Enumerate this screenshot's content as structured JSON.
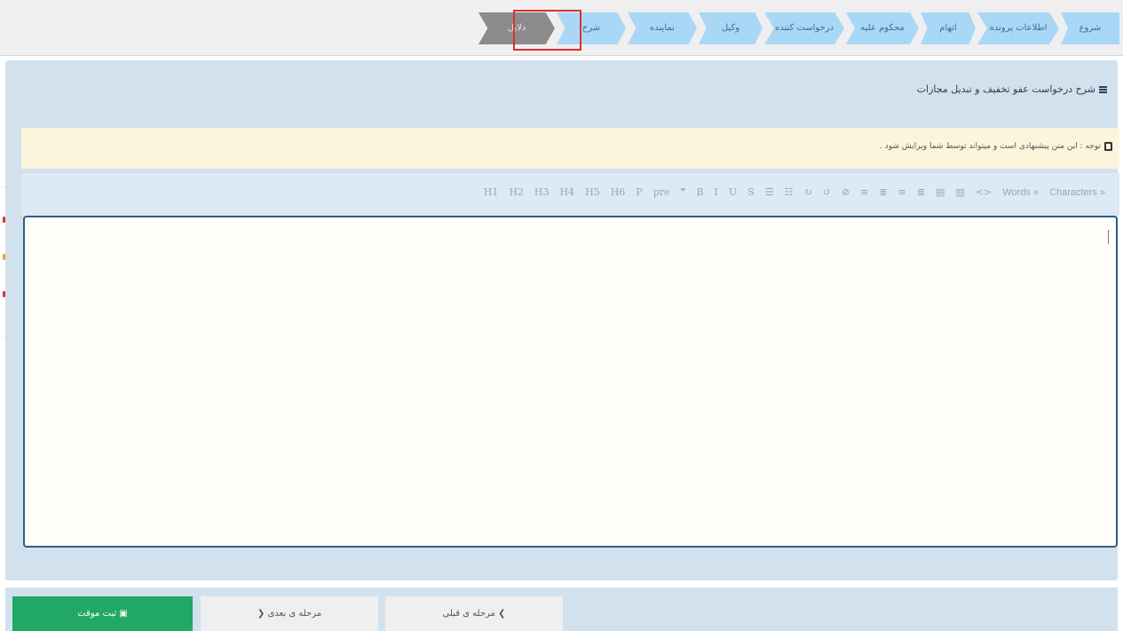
{
  "steps": [
    {
      "label": "شروع",
      "state": "normal"
    },
    {
      "label": "اطلاعات پرونده",
      "state": "normal"
    },
    {
      "label": "اتهام",
      "state": "normal"
    },
    {
      "label": "محکوم علیه",
      "state": "normal"
    },
    {
      "label": "درخواست کننده",
      "state": "normal"
    },
    {
      "label": "وکیل",
      "state": "normal"
    },
    {
      "label": "نماینده",
      "state": "normal"
    },
    {
      "label": "شرح",
      "state": "active"
    },
    {
      "label": "دلایل",
      "state": "disabled"
    }
  ],
  "panel": {
    "title": "شرح درخواست عفو تخفیف و تبدیل مجازات",
    "note": "توجه : این متن پیشنهادی است و میتواند توسط شما ویرایش شود ."
  },
  "toolbar": {
    "buttons": [
      "H1",
      "H2",
      "H3",
      "H4",
      "H5",
      "H6",
      "P",
      "pre",
      "❞",
      "B",
      "I",
      "U",
      "S",
      "☰",
      "☷",
      "↻",
      "↺",
      "⊘",
      "≡",
      "≣",
      "≡",
      "≣",
      "▤",
      "▥",
      "<>"
    ],
    "words_label": "Words »",
    "characters_label": "Characters »"
  },
  "editor": {
    "value": ""
  },
  "footer": {
    "save_label": "ثبت موقت",
    "next_label": "مرحله ی بعدی",
    "prev_label": "مرحله ی قبلی"
  },
  "colors": {
    "step_bg": "#a9d8f7",
    "step_disabled": "#8b8b8b",
    "highlight": "#d9322f",
    "panel_bg": "#d1e2ee",
    "save_bg": "#21a865"
  }
}
